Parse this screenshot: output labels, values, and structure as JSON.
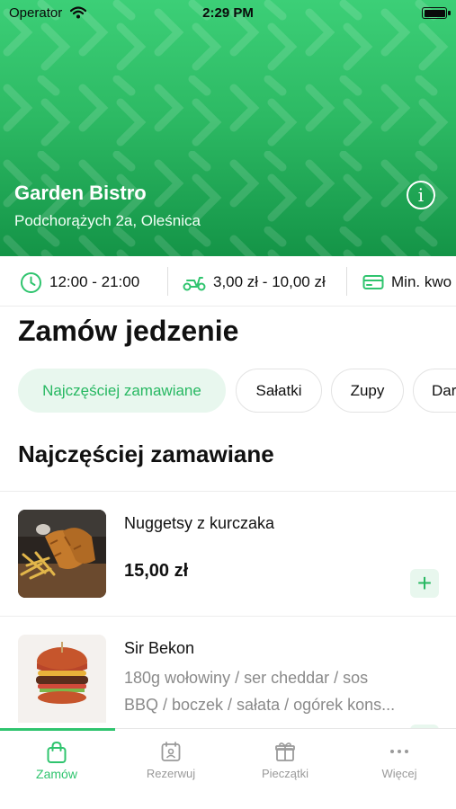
{
  "status_bar": {
    "carrier": "Operator",
    "time": "2:29 PM"
  },
  "restaurant": {
    "name": "Garden Bistro",
    "address": "Podchorążych 2a, Oleśnica",
    "info_icon": "info-icon"
  },
  "info_bar": {
    "hours": "12:00 - 21:00",
    "delivery_fee": "3,00 zł - 10,00 zł",
    "min_order": "Min. kwo"
  },
  "menu": {
    "title": "Zamów jedzenie",
    "categories": [
      "Najczęściej zamawiane",
      "Sałatki",
      "Zupy",
      "Dar"
    ],
    "active_category": "Najczęściej zamawiane",
    "section_heading": "Najczęściej zamawiane",
    "items": [
      {
        "name": "Nuggetsy z kurczaka",
        "price": "15,00 zł",
        "description": ""
      },
      {
        "name": "Sir Bekon",
        "price": "",
        "description_line1": "180g wołowiny / ser cheddar / sos",
        "description_line2": "BBQ / boczek / sałata / ogórek kons..."
      }
    ]
  },
  "tab_bar": {
    "tabs": [
      {
        "label": "Zamów",
        "icon": "shopping-bag-icon"
      },
      {
        "label": "Rezerwuj",
        "icon": "calendar-person-icon"
      },
      {
        "label": "Pieczątki",
        "icon": "gift-icon"
      },
      {
        "label": "Więcej",
        "icon": "more-dots-icon"
      }
    ],
    "active": "Zamów"
  },
  "colors": {
    "accent": "#2fc46e",
    "hero_top": "#3ccf77",
    "hero_bottom": "#149447",
    "chip_active_bg": "#e8f7ee"
  }
}
